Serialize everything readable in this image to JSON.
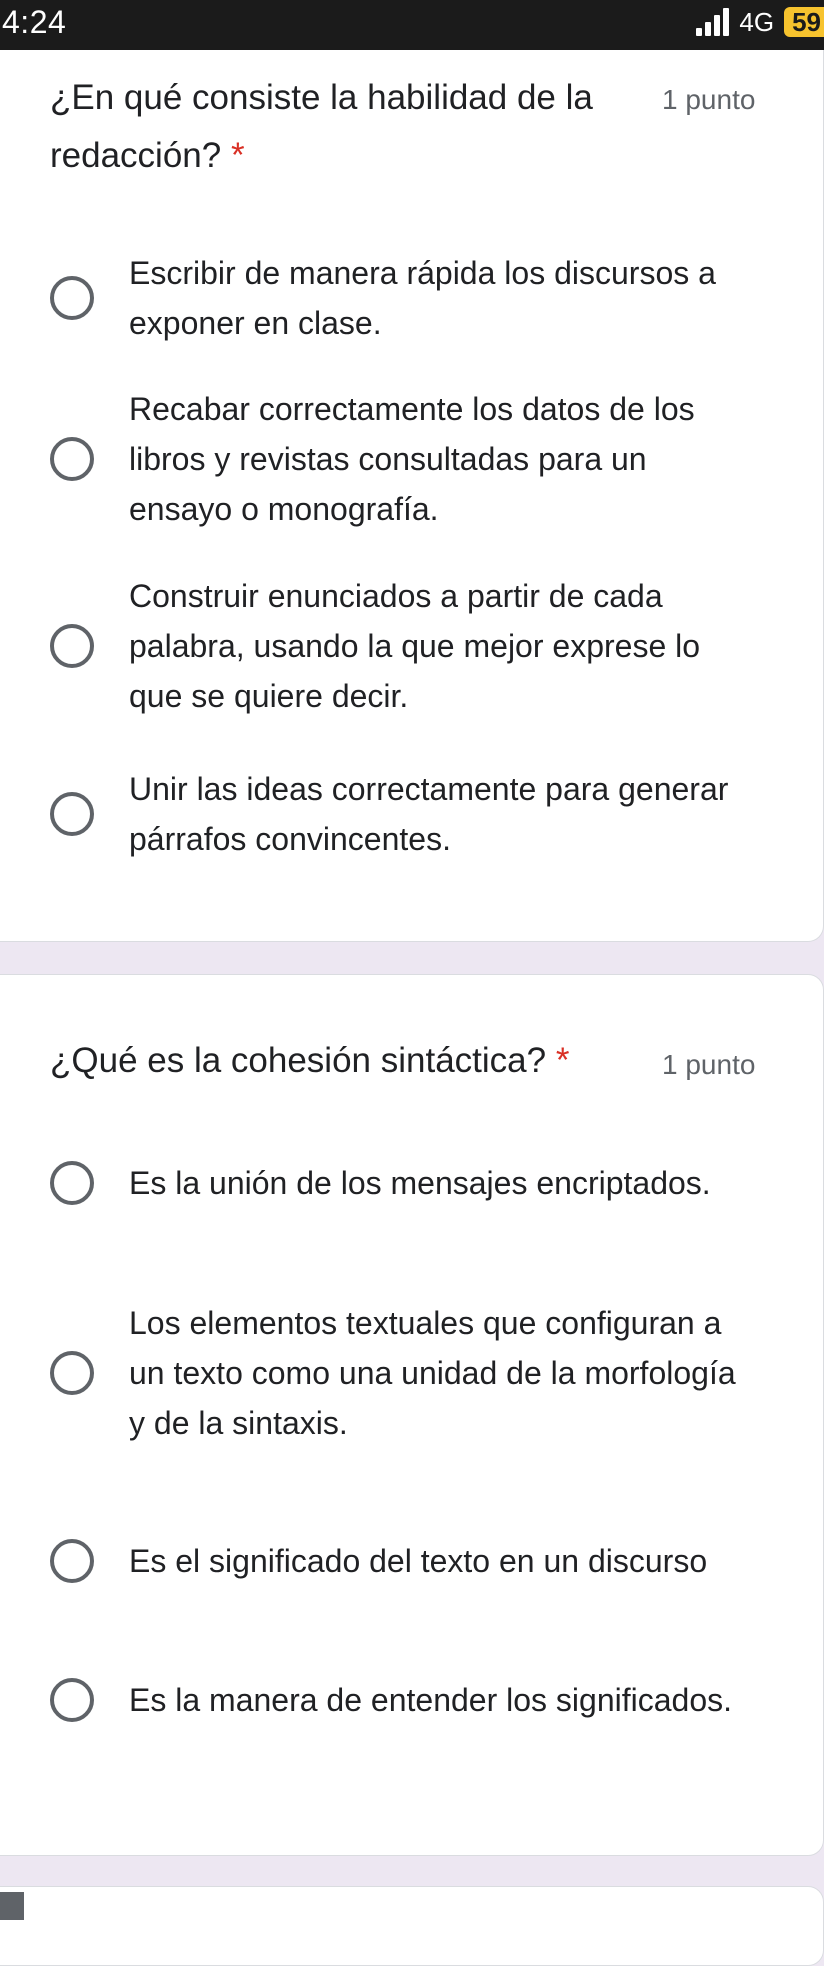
{
  "status_bar": {
    "time": "4:24",
    "network": "4G",
    "battery": "59"
  },
  "questions": [
    {
      "title": "¿En qué consiste la habilidad de la redacción?",
      "required_mark": "*",
      "points": "1 punto",
      "options": [
        "Escribir de manera rápida los discursos a exponer en clase.",
        "Recabar correctamente los datos de los libros y revistas consultadas para un ensayo o monografía.",
        "Construir enunciados a partir de cada palabra, usando la que mejor exprese lo que se quiere decir.",
        "Unir las ideas correctamente para generar párrafos convincentes."
      ]
    },
    {
      "title": "¿Qué es la cohesión sintáctica?",
      "required_mark": "*",
      "points": "1 punto",
      "options": [
        "Es la unión de los mensajes encriptados.",
        "Los elementos textuales que configuran a un texto como una unidad de la morfología y de la sintaxis.",
        "Es el significado del texto en un discurso",
        "Es la manera de entender los significados."
      ]
    }
  ],
  "colors": {
    "background": "#ede7f2",
    "required": "#d93025",
    "radio_border": "#5f6368",
    "battery": "#f7c32e"
  }
}
